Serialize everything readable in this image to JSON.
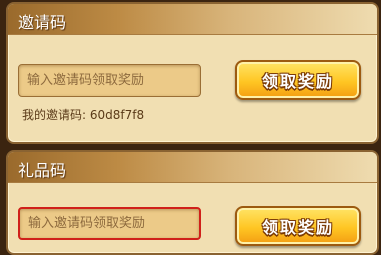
{
  "invite": {
    "title": "邀请码",
    "input_placeholder": "输入邀请码领取奖励",
    "claim_label": "领取奖励",
    "my_code_text": "我的邀请码: 60d8f7f8"
  },
  "gift": {
    "title": "礼品码",
    "input_placeholder": "输入邀请码领取奖励",
    "claim_label": "领取奖励"
  },
  "colors": {
    "panel_bg": "#f1dfb2",
    "button_gold": "#ffc623",
    "focus_border": "#d0201a"
  }
}
